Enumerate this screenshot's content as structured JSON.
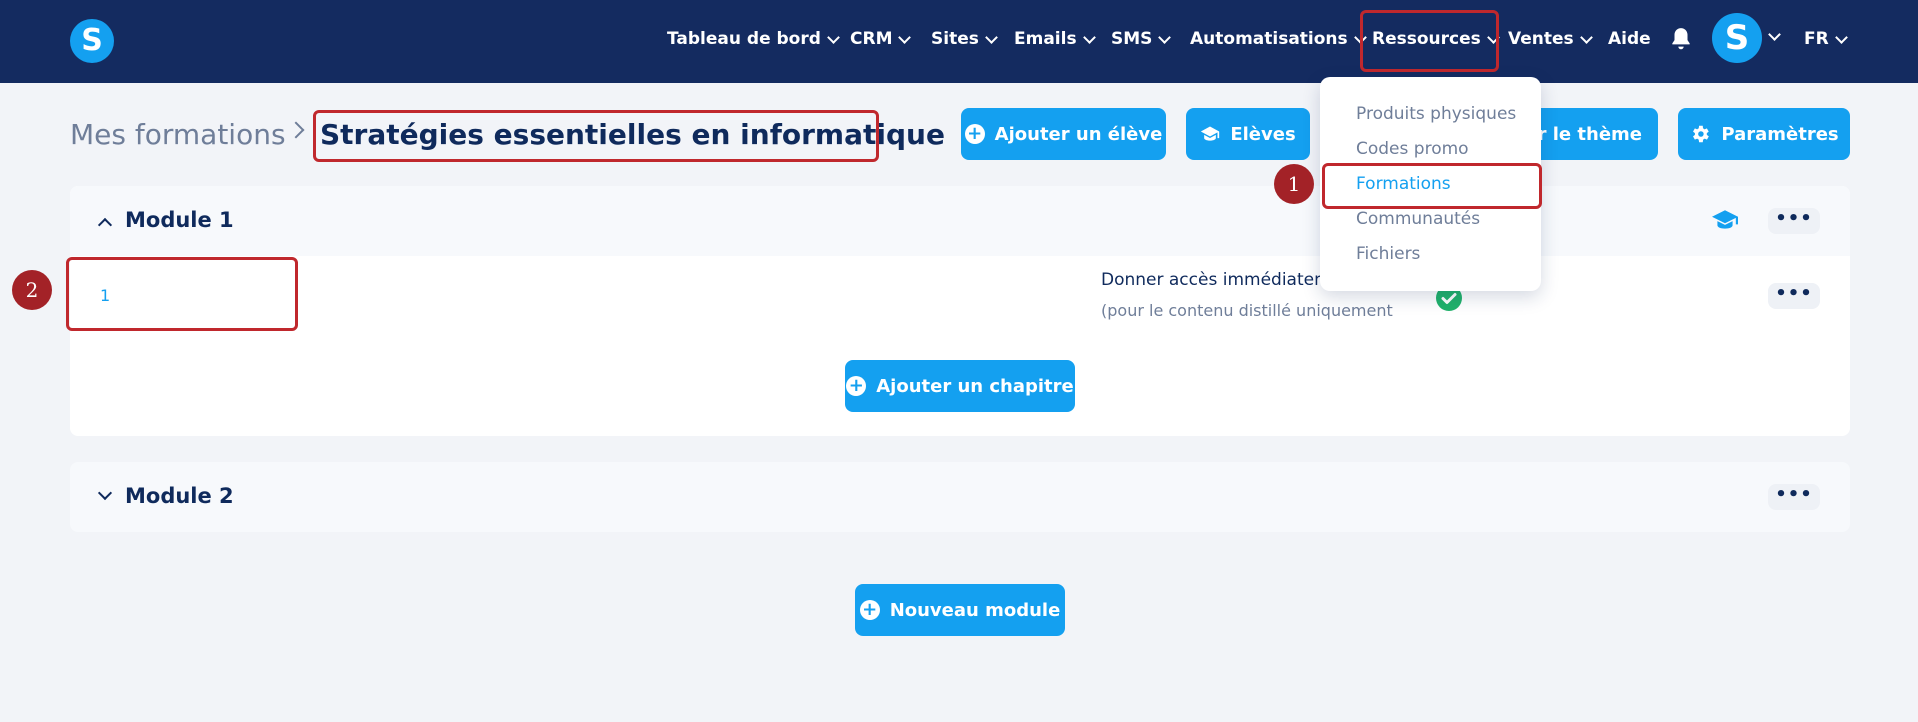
{
  "nav": {
    "logo_letter": "S",
    "items": [
      {
        "label": "Tableau de bord"
      },
      {
        "label": "CRM"
      },
      {
        "label": "Sites"
      },
      {
        "label": "Emails"
      },
      {
        "label": "SMS"
      },
      {
        "label": "Automatisations"
      },
      {
        "label": "Ressources"
      },
      {
        "label": "Ventes"
      },
      {
        "label": "Aide"
      }
    ],
    "avatar_letter": "S",
    "language": "FR"
  },
  "breadcrumb": {
    "parent": "Mes formations",
    "current": "Stratégies essentielles en informatique"
  },
  "actions": {
    "add_student": "Ajouter un élève",
    "students": "Elèves",
    "theme": "ser le thème",
    "settings": "Paramètres"
  },
  "dropdown": {
    "items": [
      {
        "label": "Produits physiques"
      },
      {
        "label": "Codes promo"
      },
      {
        "label": "Formations"
      },
      {
        "label": "Communautés"
      },
      {
        "label": "Fichiers"
      }
    ]
  },
  "modules": [
    {
      "title": "Module 1",
      "chapters": [
        {
          "number": "1",
          "access_label": "Donner accès immédiatem",
          "access_note": "(pour le contenu distillé uniquement"
        }
      ],
      "add_chapter_label": "Ajouter un chapitre"
    },
    {
      "title": "Module 2"
    }
  ],
  "new_module_label": "Nouveau module",
  "annotations": {
    "step1": "1",
    "step2": "2"
  },
  "colors": {
    "nav_bg": "#142b60",
    "accent": "#14a0f0",
    "highlight": "#c0282d",
    "success": "#20b26b"
  }
}
